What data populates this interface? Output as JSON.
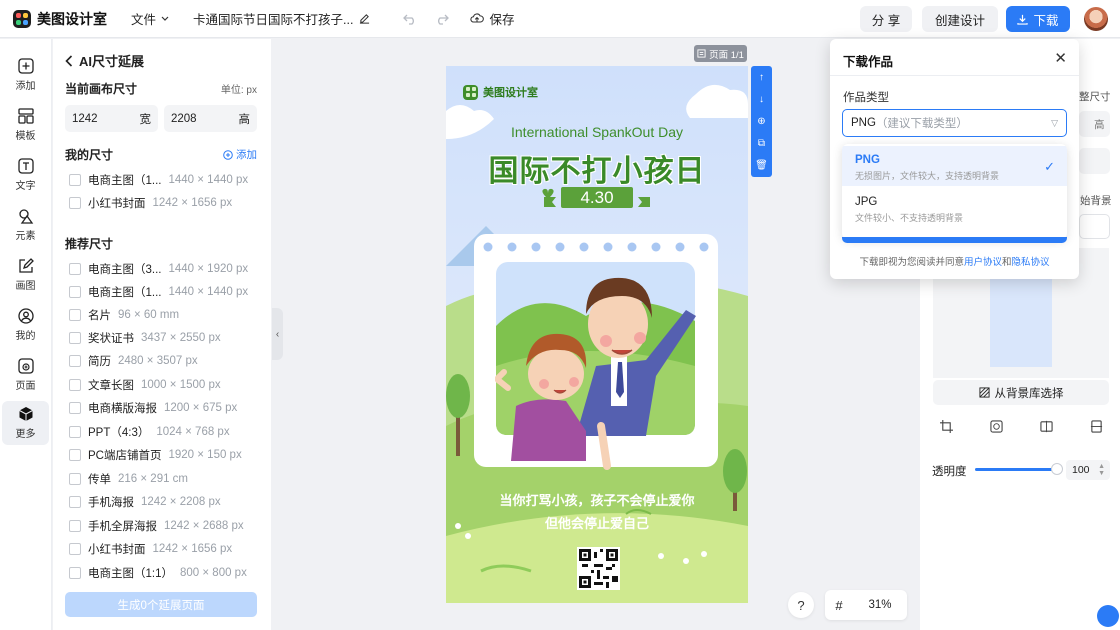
{
  "app": {
    "name": "美图设计室"
  },
  "topbar": {
    "file_menu": "文件",
    "doc_title": "卡通国际节日国际不打孩子...",
    "save_label": "保存",
    "share_label": "分 享",
    "create_label": "创建设计",
    "download_label": "下载"
  },
  "rail": {
    "items": [
      {
        "label": "添加",
        "icon": "plus-square-icon"
      },
      {
        "label": "模板",
        "icon": "template-icon"
      },
      {
        "label": "文字",
        "icon": "text-icon"
      },
      {
        "label": "元素",
        "icon": "shapes-icon"
      },
      {
        "label": "画图",
        "icon": "draw-icon"
      },
      {
        "label": "我的",
        "icon": "user-icon"
      },
      {
        "label": "页面",
        "icon": "page-add-icon"
      },
      {
        "label": "更多",
        "icon": "cube-icon"
      }
    ]
  },
  "panel": {
    "title": "AI尺寸延展",
    "current_label": "当前画布尺寸",
    "unit_label": "单位: px",
    "width_value": "1242",
    "width_suffix": "宽",
    "height_value": "2208",
    "height_suffix": "高",
    "my_sizes_label": "我的尺寸",
    "add_label": "添加",
    "my_sizes": [
      {
        "name": "电商主图（1...",
        "size": "1440 × 1440 px"
      },
      {
        "name": "小红书封面",
        "size": "1242 × 1656 px"
      }
    ],
    "recommended_label": "推荐尺寸",
    "recommended": [
      {
        "name": "电商主图（3...",
        "size": "1440 × 1920 px"
      },
      {
        "name": "电商主图（1...",
        "size": "1440 × 1440 px"
      },
      {
        "name": "名片",
        "size": "96 × 60 mm"
      },
      {
        "name": "奖状证书",
        "size": "3437 × 2550 px"
      },
      {
        "name": "简历",
        "size": "2480 × 3507 px"
      },
      {
        "name": "文章长图",
        "size": "1000 × 1500 px"
      },
      {
        "name": "电商横版海报",
        "size": "1200 × 675 px"
      },
      {
        "name": "PPT（4:3）",
        "size": "1024 × 768 px"
      },
      {
        "name": "PC端店铺首页",
        "size": "1920 × 150 px"
      },
      {
        "name": "传单",
        "size": "216 × 291 cm"
      },
      {
        "name": "手机海报",
        "size": "1242 × 2208 px"
      },
      {
        "name": "手机全屏海报",
        "size": "1242 × 2688 px"
      },
      {
        "name": "小红书封面",
        "size": "1242 × 1656 px"
      },
      {
        "name": "电商主图（1:1）",
        "size": "800 × 800 px"
      }
    ],
    "generate_label": "生成0个延展页面"
  },
  "canvas": {
    "page_tag": "页面 1/1",
    "poster": {
      "brand": "美图设计室",
      "title_en": "International SpankOut Day",
      "title_cn": "国际不打小孩日",
      "date": "4.30",
      "line1": "当你打骂小孩，孩子不会停止爱你",
      "line2": "但他会停止爱自己"
    },
    "zoom": "31%",
    "help": "?"
  },
  "right_panel": {
    "fragment_top": "整尺寸",
    "fragment_value": "高",
    "fragment_bg": "始背景",
    "bg_library_label": "从背景库选择",
    "opacity_label": "透明度",
    "opacity_value": "100",
    "opacity_level": 1.0
  },
  "download_dialog": {
    "title": "下载作品",
    "type_label": "作品类型",
    "selected_value": "PNG",
    "selected_hint": "（建议下载类型）",
    "options": [
      {
        "name": "PNG",
        "desc": "无损图片，文件较大，支持透明背景",
        "selected": true
      },
      {
        "name": "JPG",
        "desc": "文件较小、不支持透明背景",
        "selected": false
      }
    ],
    "footer_prefix": "下载即视为您阅读并同意",
    "footer_link1": "用户协议",
    "footer_and": "和",
    "footer_link2": "隐私协议"
  },
  "colors": {
    "accent": "#2b7bf6",
    "poster_green": "#3a8a28"
  }
}
